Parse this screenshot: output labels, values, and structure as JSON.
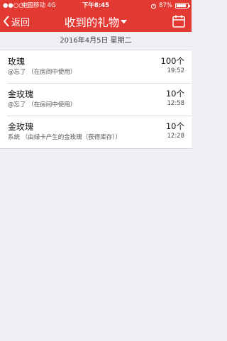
{
  "status_bar": {
    "signal": "●●○○○",
    "carrier": "中国移动 4G",
    "time": "下午8:45",
    "battery": "87%",
    "battery_level": 0.87
  },
  "nav": {
    "back_label": "返回",
    "title": "收到的礼物",
    "dropdown_icon": "caret-down-icon",
    "calendar_icon": "calendar-icon"
  },
  "date_header": "2016年4月5日 星期二",
  "gifts": [
    {
      "name": "玫瑰",
      "source": "@忘了 （在房间中使用）",
      "count": "100个",
      "time": "19:52"
    },
    {
      "name": "金玫瑰",
      "source": "@忘了 （在房间中使用）",
      "count": "10个",
      "time": "12:58"
    },
    {
      "name": "金玫瑰",
      "source": "系统 （由绿卡产生的金玫瑰（获得库存））",
      "count": "10个",
      "time": "12:28"
    }
  ],
  "colors": {
    "accent": "#e23a33",
    "background": "#efeff4"
  }
}
